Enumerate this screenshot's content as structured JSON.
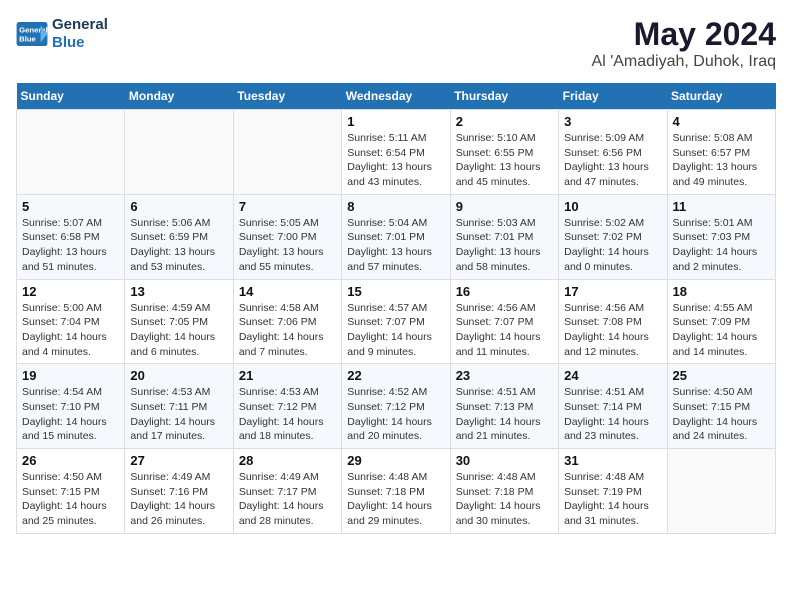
{
  "logo": {
    "line1": "General",
    "line2": "Blue"
  },
  "title": "May 2024",
  "location": "Al 'Amadiyah, Duhok, Iraq",
  "days_of_week": [
    "Sunday",
    "Monday",
    "Tuesday",
    "Wednesday",
    "Thursday",
    "Friday",
    "Saturday"
  ],
  "weeks": [
    [
      {
        "day": "",
        "sunrise": "",
        "sunset": "",
        "daylight": ""
      },
      {
        "day": "",
        "sunrise": "",
        "sunset": "",
        "daylight": ""
      },
      {
        "day": "",
        "sunrise": "",
        "sunset": "",
        "daylight": ""
      },
      {
        "day": "1",
        "sunrise": "Sunrise: 5:11 AM",
        "sunset": "Sunset: 6:54 PM",
        "daylight": "Daylight: 13 hours and 43 minutes."
      },
      {
        "day": "2",
        "sunrise": "Sunrise: 5:10 AM",
        "sunset": "Sunset: 6:55 PM",
        "daylight": "Daylight: 13 hours and 45 minutes."
      },
      {
        "day": "3",
        "sunrise": "Sunrise: 5:09 AM",
        "sunset": "Sunset: 6:56 PM",
        "daylight": "Daylight: 13 hours and 47 minutes."
      },
      {
        "day": "4",
        "sunrise": "Sunrise: 5:08 AM",
        "sunset": "Sunset: 6:57 PM",
        "daylight": "Daylight: 13 hours and 49 minutes."
      }
    ],
    [
      {
        "day": "5",
        "sunrise": "Sunrise: 5:07 AM",
        "sunset": "Sunset: 6:58 PM",
        "daylight": "Daylight: 13 hours and 51 minutes."
      },
      {
        "day": "6",
        "sunrise": "Sunrise: 5:06 AM",
        "sunset": "Sunset: 6:59 PM",
        "daylight": "Daylight: 13 hours and 53 minutes."
      },
      {
        "day": "7",
        "sunrise": "Sunrise: 5:05 AM",
        "sunset": "Sunset: 7:00 PM",
        "daylight": "Daylight: 13 hours and 55 minutes."
      },
      {
        "day": "8",
        "sunrise": "Sunrise: 5:04 AM",
        "sunset": "Sunset: 7:01 PM",
        "daylight": "Daylight: 13 hours and 57 minutes."
      },
      {
        "day": "9",
        "sunrise": "Sunrise: 5:03 AM",
        "sunset": "Sunset: 7:01 PM",
        "daylight": "Daylight: 13 hours and 58 minutes."
      },
      {
        "day": "10",
        "sunrise": "Sunrise: 5:02 AM",
        "sunset": "Sunset: 7:02 PM",
        "daylight": "Daylight: 14 hours and 0 minutes."
      },
      {
        "day": "11",
        "sunrise": "Sunrise: 5:01 AM",
        "sunset": "Sunset: 7:03 PM",
        "daylight": "Daylight: 14 hours and 2 minutes."
      }
    ],
    [
      {
        "day": "12",
        "sunrise": "Sunrise: 5:00 AM",
        "sunset": "Sunset: 7:04 PM",
        "daylight": "Daylight: 14 hours and 4 minutes."
      },
      {
        "day": "13",
        "sunrise": "Sunrise: 4:59 AM",
        "sunset": "Sunset: 7:05 PM",
        "daylight": "Daylight: 14 hours and 6 minutes."
      },
      {
        "day": "14",
        "sunrise": "Sunrise: 4:58 AM",
        "sunset": "Sunset: 7:06 PM",
        "daylight": "Daylight: 14 hours and 7 minutes."
      },
      {
        "day": "15",
        "sunrise": "Sunrise: 4:57 AM",
        "sunset": "Sunset: 7:07 PM",
        "daylight": "Daylight: 14 hours and 9 minutes."
      },
      {
        "day": "16",
        "sunrise": "Sunrise: 4:56 AM",
        "sunset": "Sunset: 7:07 PM",
        "daylight": "Daylight: 14 hours and 11 minutes."
      },
      {
        "day": "17",
        "sunrise": "Sunrise: 4:56 AM",
        "sunset": "Sunset: 7:08 PM",
        "daylight": "Daylight: 14 hours and 12 minutes."
      },
      {
        "day": "18",
        "sunrise": "Sunrise: 4:55 AM",
        "sunset": "Sunset: 7:09 PM",
        "daylight": "Daylight: 14 hours and 14 minutes."
      }
    ],
    [
      {
        "day": "19",
        "sunrise": "Sunrise: 4:54 AM",
        "sunset": "Sunset: 7:10 PM",
        "daylight": "Daylight: 14 hours and 15 minutes."
      },
      {
        "day": "20",
        "sunrise": "Sunrise: 4:53 AM",
        "sunset": "Sunset: 7:11 PM",
        "daylight": "Daylight: 14 hours and 17 minutes."
      },
      {
        "day": "21",
        "sunrise": "Sunrise: 4:53 AM",
        "sunset": "Sunset: 7:12 PM",
        "daylight": "Daylight: 14 hours and 18 minutes."
      },
      {
        "day": "22",
        "sunrise": "Sunrise: 4:52 AM",
        "sunset": "Sunset: 7:12 PM",
        "daylight": "Daylight: 14 hours and 20 minutes."
      },
      {
        "day": "23",
        "sunrise": "Sunrise: 4:51 AM",
        "sunset": "Sunset: 7:13 PM",
        "daylight": "Daylight: 14 hours and 21 minutes."
      },
      {
        "day": "24",
        "sunrise": "Sunrise: 4:51 AM",
        "sunset": "Sunset: 7:14 PM",
        "daylight": "Daylight: 14 hours and 23 minutes."
      },
      {
        "day": "25",
        "sunrise": "Sunrise: 4:50 AM",
        "sunset": "Sunset: 7:15 PM",
        "daylight": "Daylight: 14 hours and 24 minutes."
      }
    ],
    [
      {
        "day": "26",
        "sunrise": "Sunrise: 4:50 AM",
        "sunset": "Sunset: 7:15 PM",
        "daylight": "Daylight: 14 hours and 25 minutes."
      },
      {
        "day": "27",
        "sunrise": "Sunrise: 4:49 AM",
        "sunset": "Sunset: 7:16 PM",
        "daylight": "Daylight: 14 hours and 26 minutes."
      },
      {
        "day": "28",
        "sunrise": "Sunrise: 4:49 AM",
        "sunset": "Sunset: 7:17 PM",
        "daylight": "Daylight: 14 hours and 28 minutes."
      },
      {
        "day": "29",
        "sunrise": "Sunrise: 4:48 AM",
        "sunset": "Sunset: 7:18 PM",
        "daylight": "Daylight: 14 hours and 29 minutes."
      },
      {
        "day": "30",
        "sunrise": "Sunrise: 4:48 AM",
        "sunset": "Sunset: 7:18 PM",
        "daylight": "Daylight: 14 hours and 30 minutes."
      },
      {
        "day": "31",
        "sunrise": "Sunrise: 4:48 AM",
        "sunset": "Sunset: 7:19 PM",
        "daylight": "Daylight: 14 hours and 31 minutes."
      },
      {
        "day": "",
        "sunrise": "",
        "sunset": "",
        "daylight": ""
      }
    ]
  ]
}
